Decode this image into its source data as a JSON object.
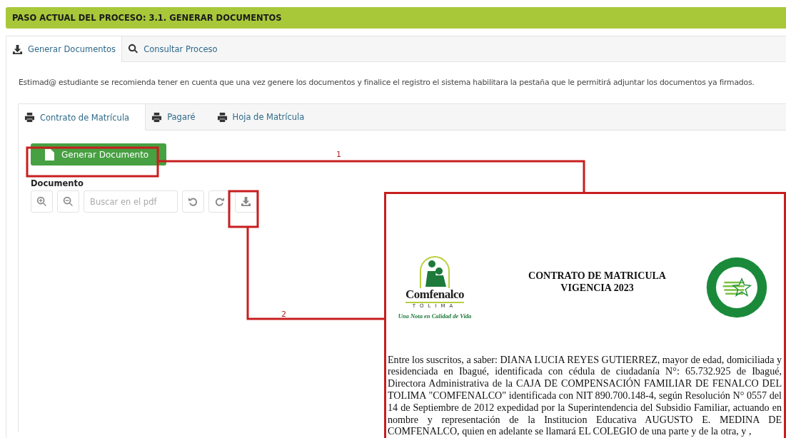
{
  "header": {
    "title": "PASO ACTUAL DEL PROCESO: 3.1. GENERAR DOCUMENTOS"
  },
  "tabs": [
    {
      "label": "Generar Documentos",
      "selected": true
    },
    {
      "label": "Consultar Proceso",
      "selected": false
    }
  ],
  "notice": "Estimad@ estudiante se recomienda tener en cuenta que una vez genere los documentos y finalice el registro el sistema habilitara la pestaña que le permitirá adjuntar los documentos ya firmados.",
  "document_tabs": [
    {
      "label": "Contrato de Matrícula",
      "selected": true
    },
    {
      "label": "Pagaré",
      "selected": false
    },
    {
      "label": "Hoja de Matrícula",
      "selected": false
    }
  ],
  "generate_button": {
    "label": "Generar Documento"
  },
  "viewer": {
    "label": "Documento",
    "search": {
      "placeholder": "Buscar en el pdf"
    }
  },
  "callouts": [
    {
      "number": "1"
    },
    {
      "number": "2"
    }
  ],
  "document_preview": {
    "logo": {
      "name": "Comfenalco",
      "region": "TOLIMA",
      "slogan": "Una Nota en Calidad de Vida"
    },
    "title_lines": [
      "CONTRATO DE MATRICULA",
      "VIGENCIA 2023"
    ],
    "paragraph": "Entre los suscritos, a saber: DIANA LUCIA REYES GUTIERREZ, mayor de edad, domiciliada y residenciada en Ibagué, identificada con cédula de ciudadanía N°: 65.732.925 de Ibagué, Directora Administrativa de la CAJA DE COMPENSACIÓN FAMILIAR DE FENALCO DEL TOLIMA \"COMFENALCO\" identificada con NIT 890.700.148-4, según Resolución N° 0557 del 14 de Septiembre de 2012 expedidad por la Superintendencia del Subsidio Familiar, actuando en nombre y representación de la Institucion Educativa AUGUSTO E. MEDINA DE COMFENALCO, quien en adelante se llamará EL COLEGIO de una parte y de la otra,  y  ,"
  }
}
